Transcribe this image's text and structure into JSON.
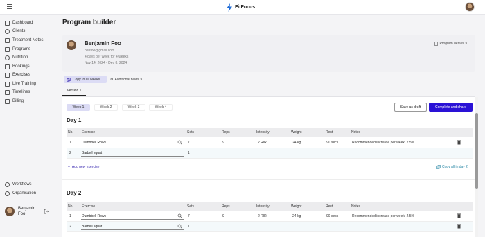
{
  "app": {
    "brand": "FitFocus"
  },
  "sidebar": {
    "items": [
      {
        "label": "Dashboard",
        "icon": "dashboard-icon"
      },
      {
        "label": "Clients",
        "icon": "clients-icon"
      },
      {
        "label": "Treatment Notes",
        "icon": "notes-icon"
      },
      {
        "label": "Programs",
        "icon": "programs-icon"
      },
      {
        "label": "Nutrition",
        "icon": "nutrition-icon"
      },
      {
        "label": "Bookings",
        "icon": "bookings-icon"
      },
      {
        "label": "Exercises",
        "icon": "exercises-icon"
      },
      {
        "label": "Live Training",
        "icon": "live-training-icon"
      },
      {
        "label": "Timelines",
        "icon": "timelines-icon"
      },
      {
        "label": "Billing",
        "icon": "billing-icon"
      }
    ],
    "bottom_items": [
      {
        "label": "Workflows",
        "icon": "workflows-icon"
      },
      {
        "label": "Organisation",
        "icon": "organisation-icon"
      }
    ],
    "user": {
      "name": "Benjamin Foo"
    }
  },
  "page": {
    "title": "Program builder"
  },
  "profile": {
    "name": "Benjamin Foo",
    "email": "benfoo@gmail.com",
    "schedule": "4 days per week for 4 weeks",
    "dates": "Nov 14, 2024 - Dec 8, 2024",
    "details_label": "Program details"
  },
  "toolbar": {
    "copy_weeks": "Copy to all weeks",
    "additional_fields": "Additional fields"
  },
  "version": {
    "label": "Version 1"
  },
  "weeks": [
    "Week 1",
    "Week 2",
    "Week 3",
    "Week 4"
  ],
  "actions": {
    "save_draft": "Save as draft",
    "complete": "Complete and share"
  },
  "table_headers": [
    "No.",
    "Exercise",
    "Sets",
    "Reps",
    "Intensity",
    "Weight",
    "Rest",
    "Notes"
  ],
  "days": [
    {
      "title": "Day 1",
      "rows": [
        {
          "no": "1",
          "exercise": "Dumbbell Rows",
          "sets": "7",
          "reps": "9",
          "intensity": "2 RIR",
          "weight": "24 kg",
          "rest": "90 secs",
          "notes": "Recommended increase per week: 2.5%"
        },
        {
          "no": "2",
          "exercise": "Barbell squat",
          "sets": "1",
          "reps": "",
          "intensity": "",
          "weight": "",
          "rest": "",
          "notes": ""
        }
      ],
      "add_label": "Add new exercise",
      "copy_label": "Copy all in day 2"
    },
    {
      "title": "Day 2",
      "rows": [
        {
          "no": "1",
          "exercise": "Dumbbell Rows",
          "sets": "7",
          "reps": "9",
          "intensity": "2 RIR",
          "weight": "24 kg",
          "rest": "90 secs",
          "notes": "Recommended increase per week: 2.5%"
        },
        {
          "no": "2",
          "exercise": "Barbell squat",
          "sets": "1",
          "reps": "",
          "intensity": "",
          "weight": "",
          "rest": "",
          "notes": ""
        }
      ]
    }
  ],
  "colors": {
    "primary": "#2a12d6",
    "active_tab": "#dcdcf5",
    "link": "#3a2ab0",
    "copy_link": "#2a88a6"
  }
}
